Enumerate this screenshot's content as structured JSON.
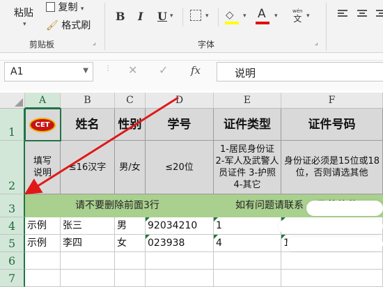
{
  "ribbon": {
    "paste_label": "粘贴",
    "copy_label": "复制",
    "format_painter_label": "格式刷",
    "clipboard_group": "剪贴板",
    "font_group": "字体",
    "bold": "B",
    "italic": "I",
    "underline": "U",
    "font_color_glyph": "A",
    "wen_top": "wén",
    "wen_char": "文"
  },
  "formula_bar": {
    "name_box": "A1",
    "cancel_glyph": "✕",
    "enter_glyph": "✓",
    "fx_glyph": "fx",
    "value": "说明"
  },
  "columns": [
    "A",
    "B",
    "C",
    "D",
    "E",
    "F"
  ],
  "rows": [
    "1",
    "2",
    "3",
    "4",
    "5",
    "6",
    "7"
  ],
  "sheet": {
    "logo_text": "CET",
    "headers": {
      "b": "姓名",
      "c": "性别",
      "d": "学号",
      "e": "证件类型",
      "f": "证件号码"
    },
    "desc": {
      "a": "填写说明",
      "b": "≤16汉字",
      "c": "男/女",
      "d": "≤20位",
      "e": "1-居民身份证 2-军人及武警人员证件 3-护照 4-其它",
      "f": "身份证必须是15位或18位，否则请选其他"
    },
    "notice_left": "请不要删除前面3行",
    "notice_right": "如有问题请联系",
    "notice_brand": "孟芸软件",
    "rows": [
      {
        "a": "示例",
        "b": "张三",
        "c": "男",
        "d": "92034210",
        "e": "1"
      },
      {
        "a": "示例",
        "b": "李四",
        "c": "女",
        "d": "023938",
        "e": "4",
        "f": "1"
      }
    ]
  },
  "colors": {
    "accent": "#217346",
    "arrow": "#e01818",
    "band": "#a9d08e",
    "header_gray": "#d9d9d9"
  }
}
